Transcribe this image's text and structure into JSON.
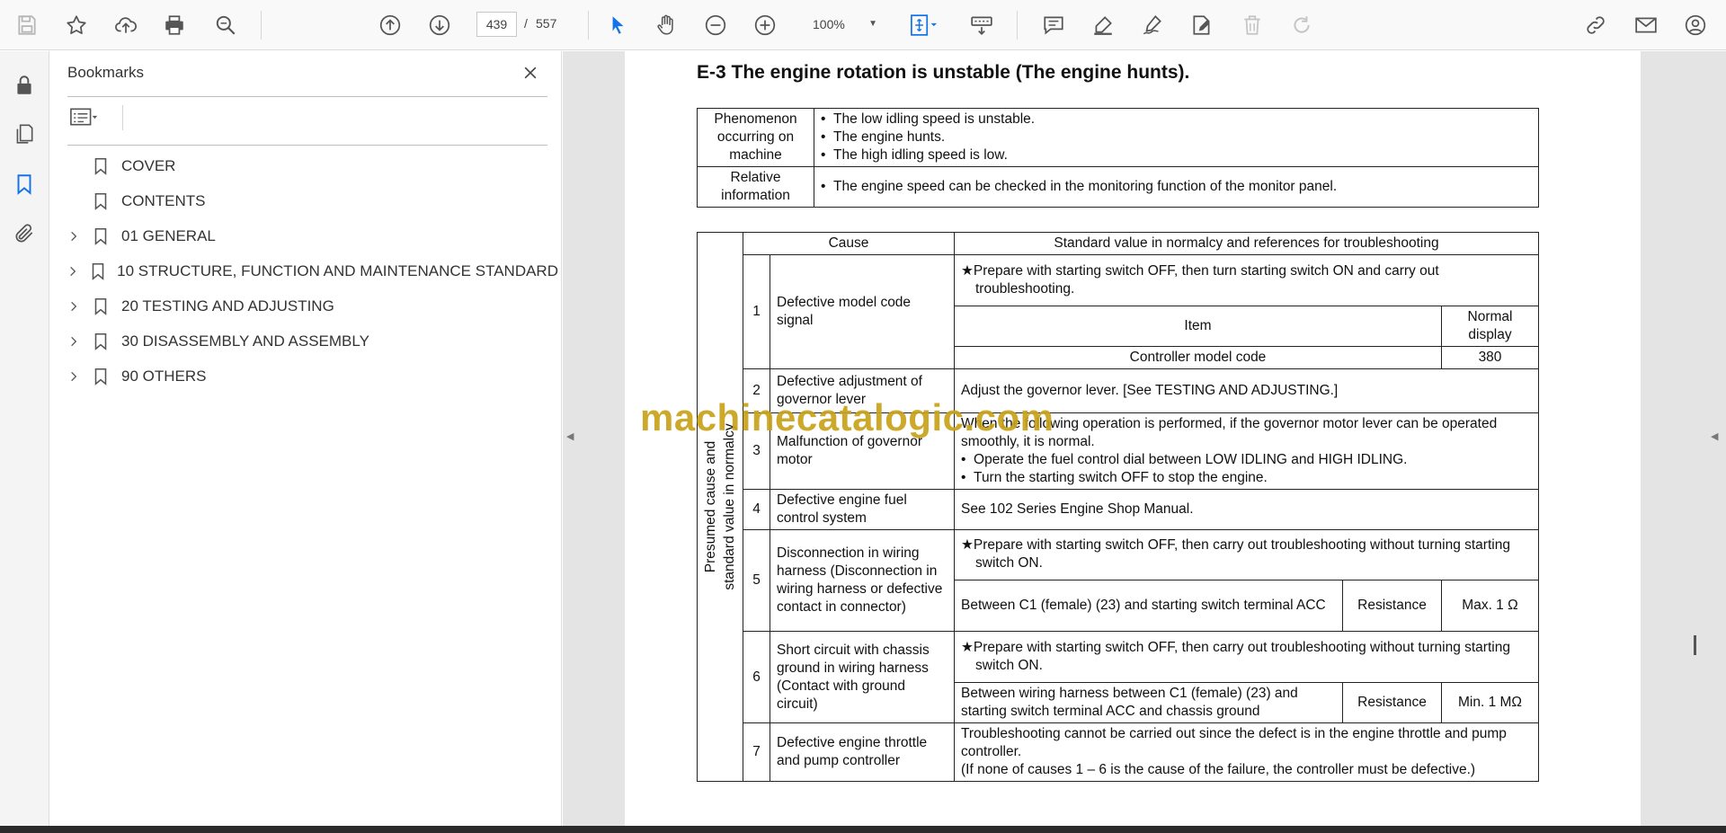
{
  "toolbar": {
    "page_current": "439",
    "page_separator": "/",
    "page_total": "557",
    "zoom": "100%"
  },
  "bookmarks": {
    "title": "Bookmarks",
    "items": [
      {
        "label": "COVER",
        "expandable": false
      },
      {
        "label": "CONTENTS",
        "expandable": false
      },
      {
        "label": "01 GENERAL",
        "expandable": true
      },
      {
        "label": "10 STRUCTURE, FUNCTION AND MAINTENANCE STANDARD",
        "expandable": true
      },
      {
        "label": "20 TESTING AND ADJUSTING",
        "expandable": true
      },
      {
        "label": "30 DISASSEMBLY AND ASSEMBLY",
        "expandable": true
      },
      {
        "label": "90 OTHERS",
        "expandable": true
      }
    ]
  },
  "document": {
    "heading": "E-3  The engine rotation is unstable (The engine hunts).",
    "info": {
      "phenomenon_label": "Phenomenon occurring on machine",
      "phenomenon_items": [
        "The low idling speed is unstable.",
        "The engine hunts.",
        "The high idling speed is low."
      ],
      "relative_label": "Relative information",
      "relative_items": [
        "The engine speed can be checked in the monitoring function of the monitor panel."
      ]
    },
    "causes": {
      "side_label_1": "Presumed cause and",
      "side_label_2": "standard value in normalcy",
      "col_cause": "Cause",
      "col_standard": "Standard value in normalcy and references for troubleshooting",
      "rows": [
        {
          "num": "1",
          "cause": "Defective model code signal",
          "note": "Prepare with starting switch OFF, then turn starting switch ON and carry out troubleshooting.",
          "item_header": "Item",
          "display_header": "Normal display",
          "item": "Controller model code",
          "display": "380"
        },
        {
          "num": "2",
          "cause": "Defective adjustment of governor lever",
          "text": "Adjust the governor lever.  [See TESTING AND ADJUSTING.]"
        },
        {
          "num": "3",
          "cause": "Malfunction of governor motor",
          "text": "When the following operation is performed, if the governor motor lever can be operated smoothly, it is normal.",
          "bullets": [
            "Operate the fuel control dial between LOW IDLING and HIGH IDLING.",
            "Turn the starting switch OFF to stop the engine."
          ]
        },
        {
          "num": "4",
          "cause": "Defective engine fuel control system",
          "text": "See 102 Series Engine Shop Manual."
        },
        {
          "num": "5",
          "cause": "Disconnection in wiring harness (Disconnection in wiring harness or defective contact in connector)",
          "note": "Prepare with starting switch OFF, then carry out troubleshooting without turning starting switch ON.",
          "check": "Between C1 (female) (23) and starting switch terminal ACC",
          "measure": "Resistance",
          "value": "Max. 1 Ω"
        },
        {
          "num": "6",
          "cause": "Short circuit with chassis ground in wiring harness (Contact with ground circuit)",
          "note": "Prepare with starting switch OFF, then carry out troubleshooting without turning starting switch ON.",
          "check": "Between wiring harness between C1 (female) (23) and starting switch terminal ACC and chassis ground",
          "measure": "Resistance",
          "value": "Min. 1 MΩ"
        },
        {
          "num": "7",
          "cause": "Defective engine throttle and pump controller",
          "text": "Troubleshooting cannot be carried out since the defect is in the engine throttle and pump controller.",
          "text2": "(If none of causes 1 – 6 is the cause of the failure, the controller must be defective.)"
        }
      ]
    },
    "watermark": "machinecatalogic.com"
  }
}
